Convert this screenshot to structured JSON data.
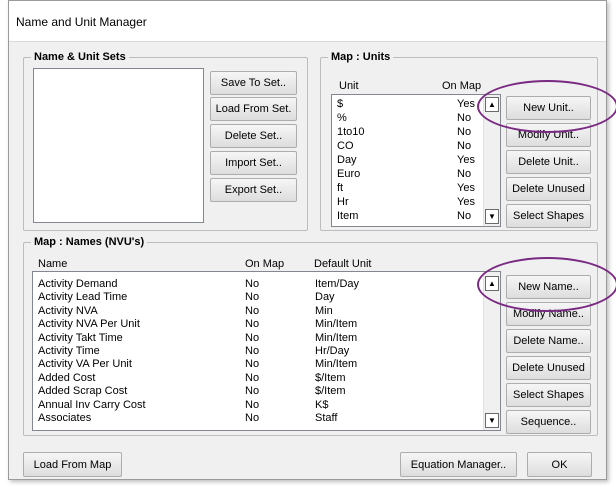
{
  "window": {
    "title": "Name and Unit Manager"
  },
  "sets": {
    "legend": "Name & Unit Sets",
    "buttons": {
      "save": "Save To Set..",
      "load": "Load From Set.",
      "delete": "Delete Set..",
      "import": "Import Set..",
      "export": "Export Set.."
    }
  },
  "units": {
    "legend": "Map : Units",
    "headers": {
      "unit": "Unit",
      "onmap": "On Map"
    },
    "rows": [
      {
        "unit": "$",
        "onmap": "Yes"
      },
      {
        "unit": "%",
        "onmap": "No"
      },
      {
        "unit": "1to10",
        "onmap": "No"
      },
      {
        "unit": "CO",
        "onmap": "No"
      },
      {
        "unit": "Day",
        "onmap": "Yes"
      },
      {
        "unit": "Euro",
        "onmap": "No"
      },
      {
        "unit": "ft",
        "onmap": "Yes"
      },
      {
        "unit": "Hr",
        "onmap": "Yes"
      },
      {
        "unit": "Item",
        "onmap": "No"
      }
    ],
    "buttons": {
      "new": "New Unit..",
      "modify": "Modify Unit..",
      "delete": "Delete Unit..",
      "delete_unused": "Delete Unused",
      "select_shapes": "Select Shapes"
    }
  },
  "names": {
    "legend": "Map : Names (NVU's)",
    "headers": {
      "name": "Name",
      "onmap": "On Map",
      "unit": "Default Unit"
    },
    "rows": [
      {
        "name": "Activity Demand",
        "onmap": "No",
        "unit": "Item/Day"
      },
      {
        "name": "Activity Lead Time",
        "onmap": "No",
        "unit": "Day"
      },
      {
        "name": "Activity NVA",
        "onmap": "No",
        "unit": "Min"
      },
      {
        "name": "Activity NVA Per Unit",
        "onmap": "No",
        "unit": "Min/Item"
      },
      {
        "name": "Activity Takt Time",
        "onmap": "No",
        "unit": "Min/Item"
      },
      {
        "name": "Activity Time",
        "onmap": "No",
        "unit": "Hr/Day"
      },
      {
        "name": "Activity VA Per Unit",
        "onmap": "No",
        "unit": "Min/Item"
      },
      {
        "name": "Added Cost",
        "onmap": "No",
        "unit": "$/Item"
      },
      {
        "name": "Added Scrap Cost",
        "onmap": "No",
        "unit": "$/Item"
      },
      {
        "name": "Annual Inv Carry Cost",
        "onmap": "No",
        "unit": "K$"
      },
      {
        "name": "Associates",
        "onmap": "No",
        "unit": "Staff"
      }
    ],
    "buttons": {
      "new": "New Name..",
      "modify": "Modify Name..",
      "delete": "Delete Name..",
      "delete_unused": "Delete Unused",
      "select_shapes": "Select Shapes",
      "sequence": "Sequence.."
    }
  },
  "footer": {
    "load_from_map": "Load From Map",
    "equation_manager": "Equation Manager..",
    "ok": "OK"
  },
  "icons": {
    "scroll_up": "▲",
    "scroll_down": "▼"
  },
  "colors": {
    "highlight_oval": "#7a2a82"
  }
}
